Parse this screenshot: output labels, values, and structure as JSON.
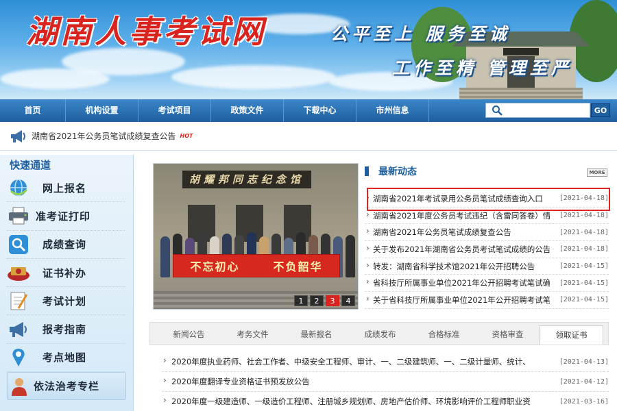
{
  "banner": {
    "site_title": "湖南人事考试网",
    "slogan_line1": "公平至上  服务至诚",
    "slogan_line2": "工作至精  管理至严",
    "colors": {
      "sky_top": "#2f8fd6",
      "title_red": "#d8231f"
    }
  },
  "nav": {
    "items": [
      "首页",
      "机构设置",
      "考试项目",
      "政策文件",
      "下载中心",
      "市州信息"
    ],
    "search_placeholder": "",
    "go_label": "GO",
    "color": "#1e5f9f"
  },
  "ticker": {
    "text": "湖南省2021年公务员笔试成绩复查公告",
    "badge": "HOT"
  },
  "sidebar": {
    "title": "快速通道",
    "items": [
      {
        "label": "网上报名",
        "icon": "globe-icon"
      },
      {
        "label": "准考证打印",
        "icon": "printer-icon"
      },
      {
        "label": "成绩查询",
        "icon": "magnifier-icon"
      },
      {
        "label": "证书补办",
        "icon": "certificate-icon"
      },
      {
        "label": "考试计划",
        "icon": "clipboard-icon"
      },
      {
        "label": "报考指南",
        "icon": "megaphone-icon"
      },
      {
        "label": "考点地图",
        "icon": "map-pin-icon"
      },
      {
        "label": "依法治考专栏",
        "icon": "person-icon"
      }
    ]
  },
  "slideshow": {
    "plaque": "胡耀邦同志纪念馆",
    "banner_left": "不忘初心",
    "banner_right": "不负韶华",
    "pages": [
      "1",
      "2",
      "3",
      "4"
    ],
    "active_page": 3
  },
  "news": {
    "title": "最新动态",
    "more_label": "MORE",
    "items": [
      {
        "text": "湖南省2021年考试录用公务员笔试成绩查询入口",
        "date": "[2021-04-18]"
      },
      {
        "text": "湖南省2021年度公务员考试违纪（含雷同答卷）情",
        "date": "[2021-04-18]"
      },
      {
        "text": "湖南省2021年公务员笔试成绩复查公告",
        "date": "[2021-04-18]"
      },
      {
        "text": "关于发布2021年湖南省公务员考试笔试成绩的公告",
        "date": "[2021-04-18]"
      },
      {
        "text": "转发：湖南省科学技术馆2021年公开招聘公告",
        "date": "[2021-04-15]"
      },
      {
        "text": "省科技厅所属事业单位2021年公开招聘考试笔试确",
        "date": "[2021-04-15]"
      },
      {
        "text": "关于省科技厅所属事业单位2021年公开招聘考试笔",
        "date": "[2021-04-15]"
      }
    ]
  },
  "tabs": {
    "labels": [
      "新闻公告",
      "考务文件",
      "最新报名",
      "成绩发布",
      "合格标准",
      "资格审查",
      "领取证书"
    ],
    "active_index": 6,
    "items": [
      {
        "text": "2020年度执业药师、社会工作者、中级安全工程师、审计、一、二级建筑师、一、二级计量师、统计、",
        "date": "[2021-04-13]"
      },
      {
        "text": "2020年度翻译专业资格证书预发放公告",
        "date": "[2021-04-12]"
      },
      {
        "text": "2020年度一级建造师、一级造价工程师、注册城乡规划师、房地产估价师、环境影响评价工程师职业资",
        "date": "[2021-03-16]"
      }
    ]
  }
}
